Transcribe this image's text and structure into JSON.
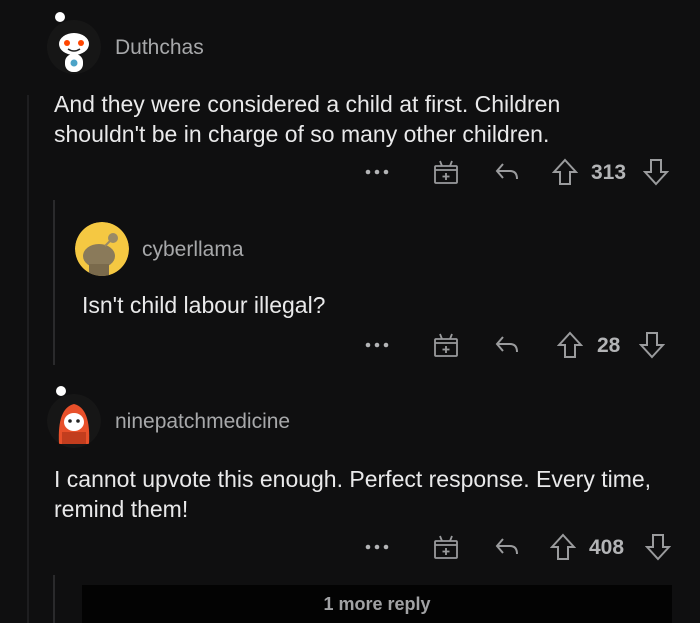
{
  "comments": [
    {
      "username": "Duthchas",
      "body": "And they were considered a child at first. Children shouldn't be in charge of so many other children.",
      "score": "313",
      "avatar": "reddit-snoo-white-icon"
    },
    {
      "username": "cyberllama",
      "body": "Isn't child labour illegal?",
      "score": "28",
      "avatar": "reddit-snoo-yellow-icon"
    },
    {
      "username": "ninepatchmedicine",
      "body": "I cannot upvote this enough. Perfect response. Every time, remind them!",
      "score": "408",
      "avatar": "reddit-snoo-red-hood-icon"
    }
  ],
  "more_replies_label": "1 more reply",
  "colors": {
    "background": "#0f0f10",
    "username": "#a7a8aa",
    "text": "#e9e9ea",
    "icon": "#9a9b9d"
  }
}
